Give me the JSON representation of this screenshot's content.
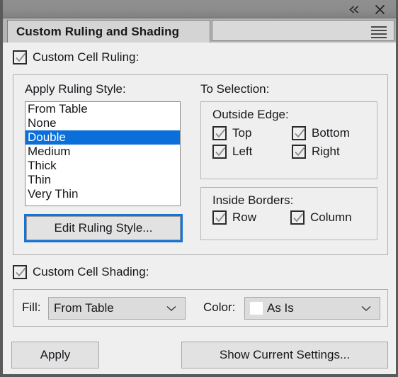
{
  "window": {
    "collapse_icon": "chevrons-left-icon",
    "close_icon": "close-icon"
  },
  "tab": {
    "label": "Custom Ruling and Shading",
    "menu_icon": "hamburger-menu-icon"
  },
  "ruling": {
    "enable_label": "Custom Cell Ruling:",
    "enabled": true,
    "apply_style_label": "Apply Ruling Style:",
    "styles": [
      "From Table",
      "None",
      "Double",
      "Medium",
      "Thick",
      "Thin",
      "Very Thin"
    ],
    "selected_style": "Double",
    "edit_button_label": "Edit Ruling Style...",
    "to_selection_label": "To Selection:",
    "outside_edge": {
      "title": "Outside Edge:",
      "top_label": "Top",
      "bottom_label": "Bottom",
      "left_label": "Left",
      "right_label": "Right",
      "top_checked": true,
      "bottom_checked": true,
      "left_checked": true,
      "right_checked": true
    },
    "inside_borders": {
      "title": "Inside Borders:",
      "row_label": "Row",
      "column_label": "Column",
      "row_checked": true,
      "column_checked": true
    }
  },
  "shading": {
    "enable_label": "Custom Cell Shading:",
    "enabled": true,
    "fill_label": "Fill:",
    "fill_value": "From Table",
    "color_label": "Color:",
    "color_value": "As Is",
    "color_swatch": "#ffffff"
  },
  "footer": {
    "apply_label": "Apply",
    "show_settings_label": "Show Current Settings..."
  },
  "colors": {
    "selection_blue": "#0a6fd8",
    "focus_blue": "#1473d6",
    "panel_bg": "#efefef",
    "titlebar": "#8c8c8c"
  }
}
